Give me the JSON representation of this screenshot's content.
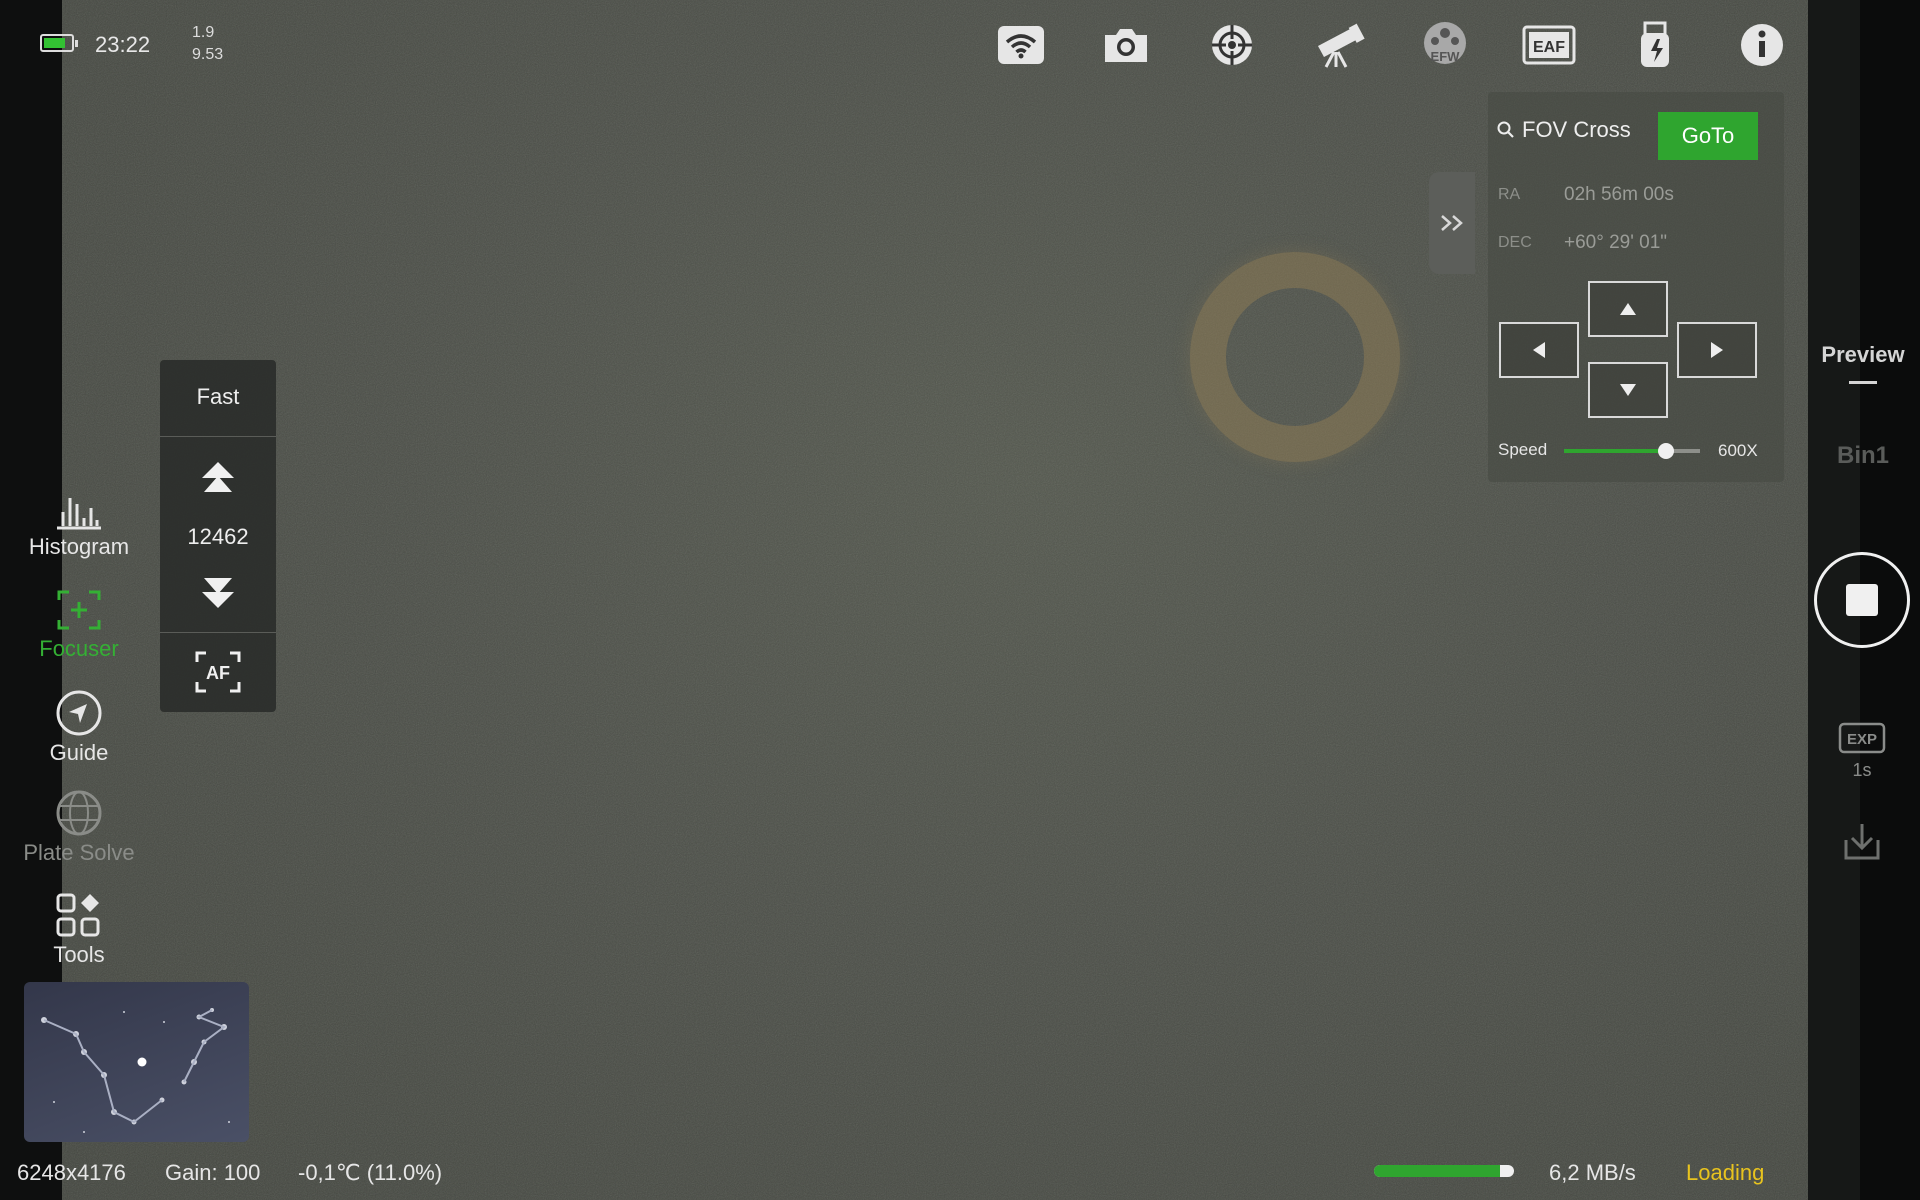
{
  "status": {
    "time": "23:22",
    "top_value": "1.9",
    "bottom_value": "9.53",
    "battery_level": 0.75
  },
  "top_icons": [
    "wifi-icon",
    "camera-icon",
    "crosshair-icon",
    "telescope-icon",
    "efw-icon",
    "eaf-icon",
    "usb-power-icon",
    "info-icon"
  ],
  "icon_labels": {
    "efw": "EFW",
    "eaf": "EAF",
    "af": "AF",
    "exp": "EXP"
  },
  "left_tools": [
    {
      "label": "Histogram",
      "icon": "histogram-icon"
    },
    {
      "label": "Focuser",
      "icon": "focuser-icon",
      "active": true
    },
    {
      "label": "Guide",
      "icon": "guide-icon"
    },
    {
      "label": "Plate Solve",
      "icon": "plate-solve-icon",
      "disabled": true
    },
    {
      "label": "Tools",
      "icon": "tools-icon"
    }
  ],
  "focuser": {
    "mode": "Fast",
    "position": "12462"
  },
  "mount": {
    "target": "FOV Cross",
    "goto_label": "GoTo",
    "ra_label": "RA",
    "ra_value": "02h 56m 00s",
    "dec_label": "DEC",
    "dec_value": "+60° 29' 01\"",
    "speed_label": "Speed",
    "speed_value": "600X",
    "speed_level": 0.75
  },
  "right_panel": {
    "preview_label": "Preview",
    "bin_label": "Bin1",
    "exp_value": "1s"
  },
  "bottom": {
    "resolution": "6248x4176",
    "gain": "Gain: 100",
    "temperature": "-0,1℃  (11.0%)",
    "transfer_rate": "6,2 MB/s",
    "state": "Loading",
    "progress": 0.9
  },
  "colors": {
    "accent_green": "#2fa52f",
    "loading_yellow": "#e8c31e",
    "active_green": "#34b034"
  }
}
